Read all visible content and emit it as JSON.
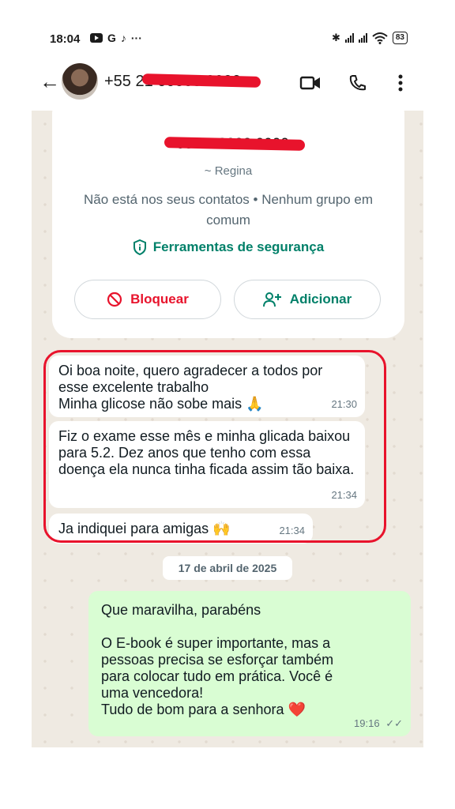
{
  "status_bar": {
    "time": "18:04",
    "app_g": "G",
    "tiktok": "♪",
    "more": "···",
    "bluetooth": "✱",
    "wifi": "wifi",
    "battery": "83"
  },
  "header": {
    "contact_number": "+55 21 00000 0000"
  },
  "info_card": {
    "number": "+55 21 0000 0000",
    "alias": "~ Regina",
    "notice": "Não está nos seus contatos • Nenhum grupo em comum",
    "safety_tools": "Ferramentas de segurança",
    "block_label": "Bloquear",
    "add_label": "Adicionar"
  },
  "messages": [
    {
      "direction": "in",
      "text": "Oi boa noite, quero agradecer a todos por esse excelente trabalho\nMinha glicose não sobe mais 🙏",
      "time": "21:30"
    },
    {
      "direction": "in",
      "text": "Fiz o exame esse mês e minha glicada baixou para 5.2.  Dez anos que tenho com essa doença ela nunca tinha ficada assim tão baixa.",
      "time": "21:34"
    },
    {
      "direction": "in",
      "text": "Ja indiquei para amigas 🙌",
      "time": "21:34"
    }
  ],
  "date_separator": "17 de abril de 2025",
  "reply": {
    "lines": [
      "Que maravilha, parabéns",
      "",
      "O E-book é super importante, mas a",
      "pessoas precisa se esforçar também",
      "para colocar tudo em prática. Você é",
      "uma vencedora!",
      "Tudo de bom para a senhora ❤️"
    ],
    "time": "19:16",
    "ticks": "✓✓"
  },
  "colors": {
    "chat_bg": "#efeae2",
    "outgoing_bubble": "#d9fdd3",
    "accent_green": "#008069",
    "alert_red": "#e8132c"
  }
}
